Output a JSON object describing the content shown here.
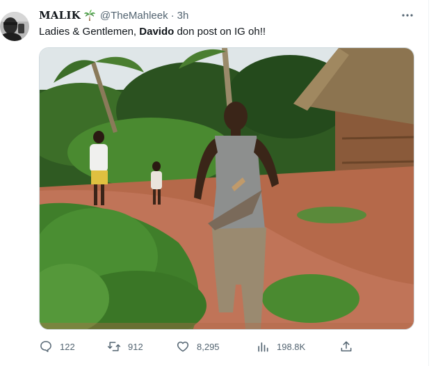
{
  "tweet": {
    "display_name": "MALIK",
    "emoji": "palm-tree",
    "handle": "@TheMahleek",
    "separator": "·",
    "time": "3h",
    "text_pre": "Ladies & Gentlemen, ",
    "text_bold": "Davido",
    "text_post": " don post on IG oh!!"
  },
  "actions": {
    "replies": "122",
    "retweets": "912",
    "likes": "8,295",
    "views": "198.8K"
  },
  "colors": {
    "secondary_text": "#536471",
    "border": "#cfd9de"
  },
  "icons": [
    "avatar",
    "palm-tree-icon",
    "more-icon",
    "reply-icon",
    "retweet-icon",
    "like-icon",
    "views-icon",
    "share-icon"
  ]
}
